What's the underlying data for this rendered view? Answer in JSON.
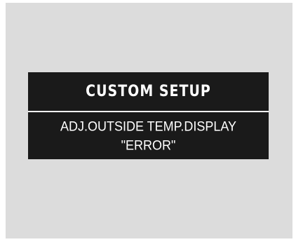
{
  "display": {
    "title": "CUSTOM SETUP",
    "message_line1": "ADJ.OUTSIDE TEMP.DISPLAY",
    "message_line2": "\"ERROR\""
  },
  "colors": {
    "background": "#dcdcdc",
    "panel": "#1a1a1a",
    "text": "#ffffff"
  }
}
